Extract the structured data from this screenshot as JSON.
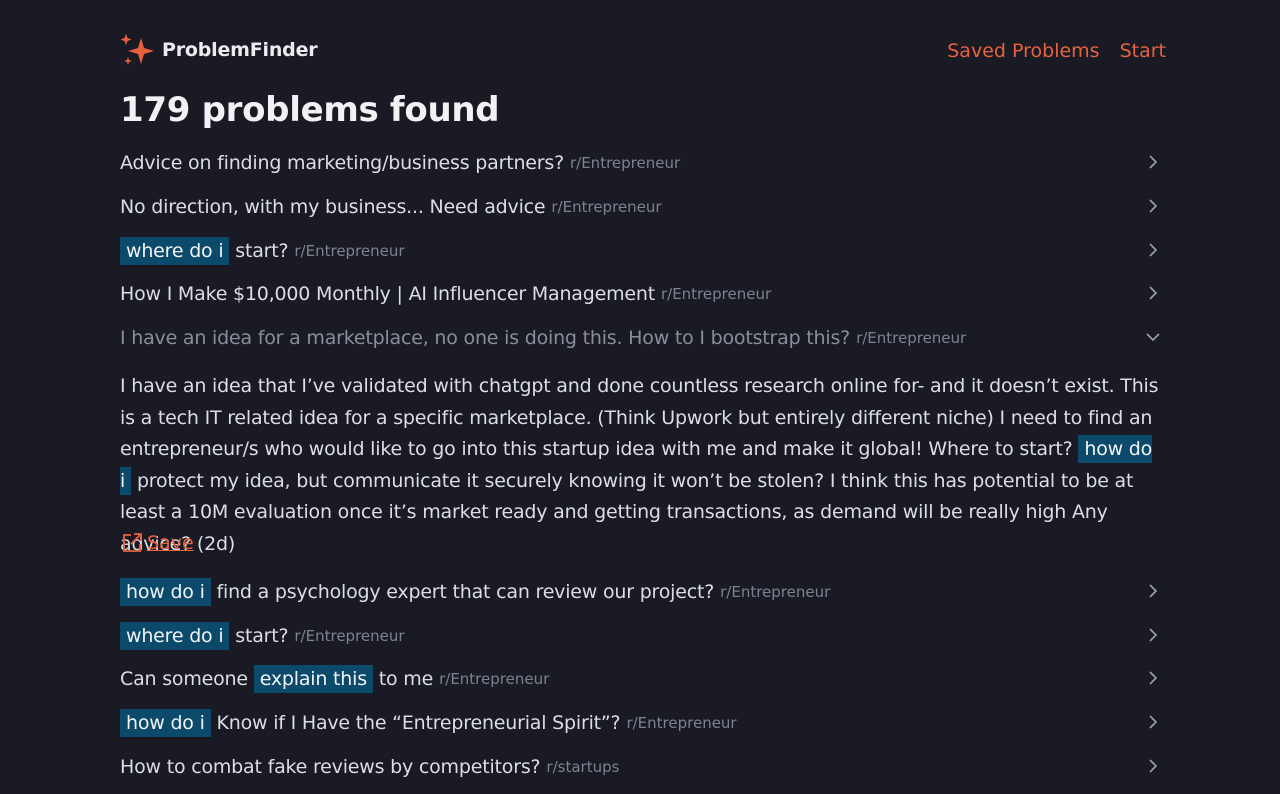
{
  "app": {
    "name": "ProblemFinder",
    "accent": "#e8613e"
  },
  "nav": {
    "saved": "Saved Problems",
    "start": "Start"
  },
  "heading": "179 problems found",
  "problems": [
    {
      "pre": "",
      "hl": "",
      "post": "Advice on finding marketing/business partners?",
      "sub": "r/Entrepreneur"
    },
    {
      "pre": "",
      "hl": "",
      "post": "No direction, with my business... Need advice",
      "sub": "r/Entrepreneur"
    },
    {
      "pre": "",
      "hl": "where do i",
      "post": "start?",
      "sub": "r/Entrepreneur"
    },
    {
      "pre": "",
      "hl": "",
      "post": "How I Make $10,000 Monthly | AI Influencer Management",
      "sub": "r/Entrepreneur"
    },
    {
      "pre": "",
      "hl": "",
      "post": "I have an idea for a marketplace, no one is doing this. How to I bootstrap this?",
      "sub": "r/Entrepreneur"
    },
    {
      "pre": "",
      "hl": "how do i",
      "post": "find a psychology expert that can review our project?",
      "sub": "r/Entrepreneur"
    },
    {
      "pre": "",
      "hl": "where do i",
      "post": "start?",
      "sub": "r/Entrepreneur"
    },
    {
      "pre": "Can someone",
      "hl": "explain this",
      "post": "to me",
      "sub": "r/Entrepreneur"
    },
    {
      "pre": "",
      "hl": "how do i",
      "post": "Know if I Have the “Entrepreneurial Spirit”?",
      "sub": "r/Entrepreneur"
    },
    {
      "pre": "",
      "hl": "",
      "post": "How to combat fake reviews by competitors?",
      "sub": "r/startups"
    }
  ],
  "expanded": {
    "body_pre": "I have an idea that I’ve validated with chatgpt and done countless research online for- and it doesn’t exist. This is a tech IT related idea for a specific marketplace. (Think Upwork but entirely different niche) I need to find an entrepreneur/s who would like to go into this startup idea with me and make it global! Where to start?",
    "body_hl": "how do i",
    "body_post": "protect my idea, but communicate it securely knowing it won’t be stolen? I think this has potential to be at least a 10M evaluation once it’s market ready and getting transactions, as demand will be really high Any advice? (2d)",
    "save_label": "Save"
  },
  "icons": {
    "brand": "sparkle-icon",
    "row": "chevron-right-icon",
    "expanded_row": "chevron-down-icon",
    "save": "external-link-icon"
  }
}
